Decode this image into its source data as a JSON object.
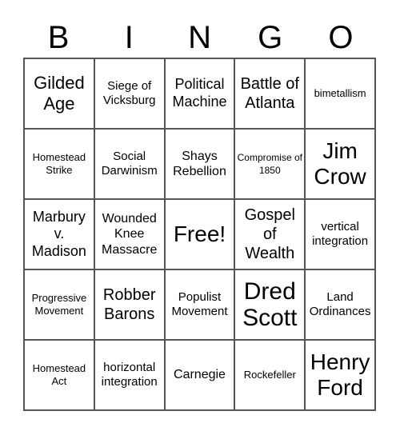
{
  "header": [
    "B",
    "I",
    "N",
    "G",
    "O"
  ],
  "cells": [
    {
      "text": "Gilded Age",
      "size": "s22"
    },
    {
      "text": "Siege of Vicksburg",
      "size": "s15"
    },
    {
      "text": "Political Machine",
      "size": "s18"
    },
    {
      "text": "Battle of Atlanta",
      "size": "s20"
    },
    {
      "text": "bimetallism",
      "size": "s13"
    },
    {
      "text": "Homestead Strike",
      "size": "s13"
    },
    {
      "text": "Social Darwinism",
      "size": "s15"
    },
    {
      "text": "Shays Rebellion",
      "size": "s16"
    },
    {
      "text": "Compromise of 1850",
      "size": "s11"
    },
    {
      "text": "Jim Crow",
      "size": "s28"
    },
    {
      "text": "Marbury v. Madison",
      "size": "s18"
    },
    {
      "text": "Wounded Knee Massacre",
      "size": "s16"
    },
    {
      "text": "Free!",
      "size": "s28"
    },
    {
      "text": "Gospel of Wealth",
      "size": "s20"
    },
    {
      "text": "vertical integration",
      "size": "s15"
    },
    {
      "text": "Progressive Movement",
      "size": "s13"
    },
    {
      "text": "Robber Barons",
      "size": "s20"
    },
    {
      "text": "Populist Movement",
      "size": "s15"
    },
    {
      "text": "Dred Scott",
      "size": "s30"
    },
    {
      "text": "Land Ordinances",
      "size": "s15"
    },
    {
      "text": "Homestead Act",
      "size": "s13"
    },
    {
      "text": "horizontal integration",
      "size": "s15"
    },
    {
      "text": "Carnegie",
      "size": "s16"
    },
    {
      "text": "Rockefeller",
      "size": "s13"
    },
    {
      "text": "Henry Ford",
      "size": "s28"
    }
  ]
}
